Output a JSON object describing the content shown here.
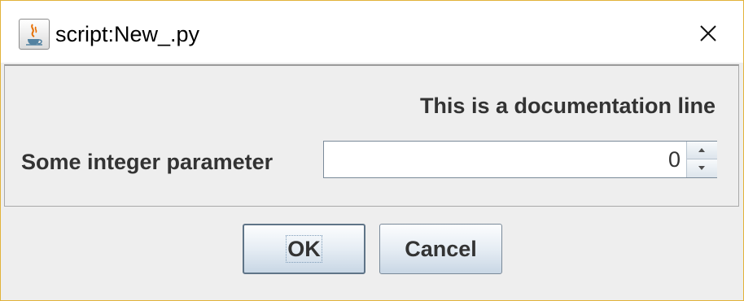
{
  "window": {
    "title": "script:New_.py",
    "app_icon": "java-coffee-cup-icon",
    "close_icon": "close-icon",
    "accent_border": "#e2b33a"
  },
  "form": {
    "documentation": "This is a documentation line",
    "parameter_label": "Some integer parameter",
    "parameter_value": "0"
  },
  "buttons": {
    "ok_label": "OK",
    "cancel_label": "Cancel"
  }
}
